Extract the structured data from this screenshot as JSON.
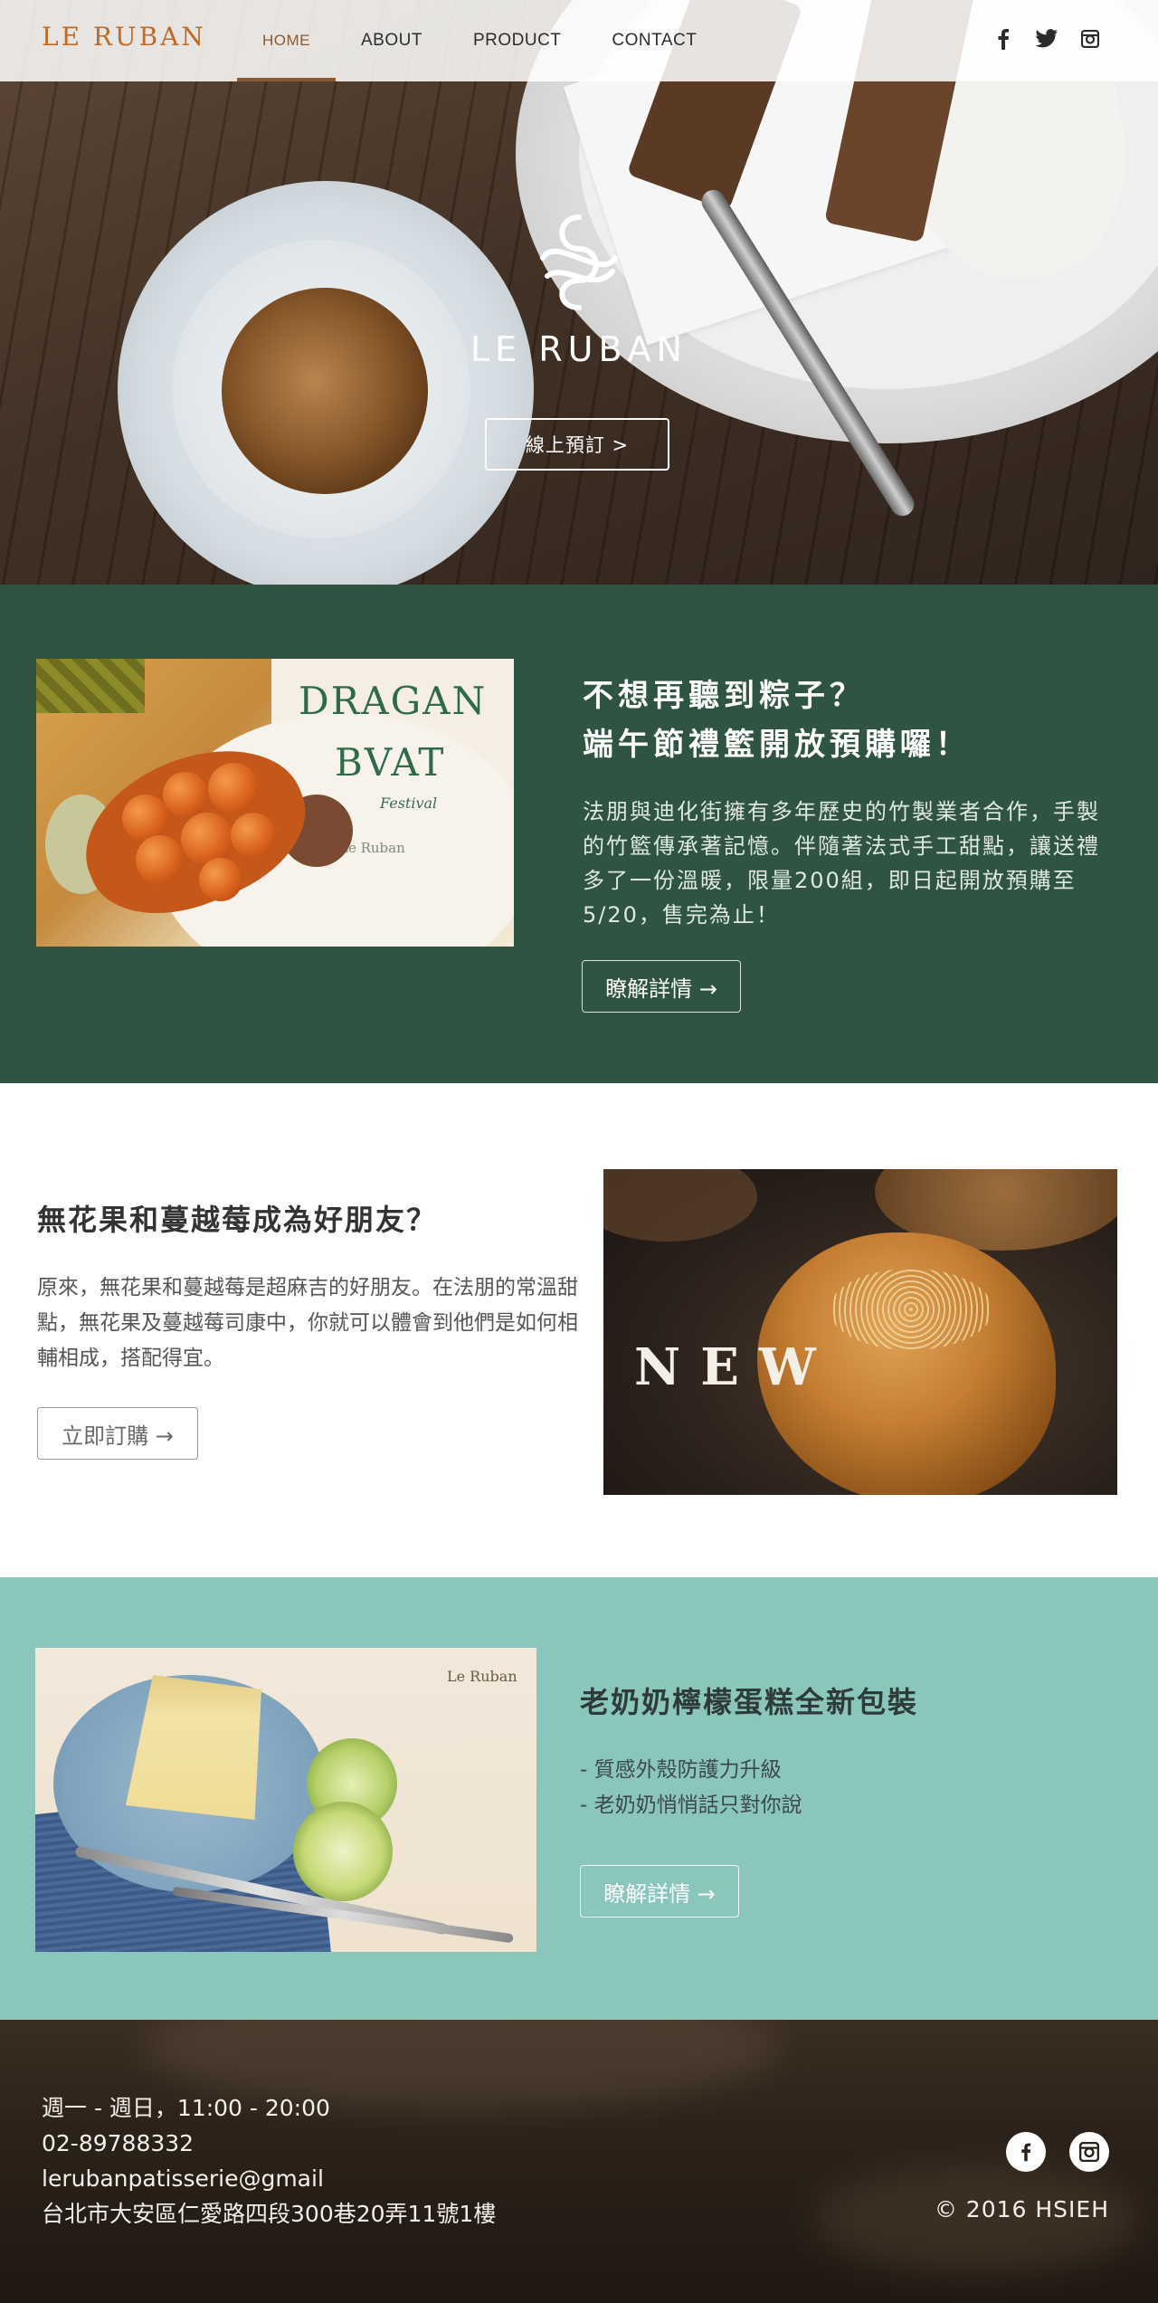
{
  "brand": {
    "logo": "LE RUBAN",
    "accent": "#c06a25"
  },
  "nav": {
    "links": [
      {
        "label": "HOME",
        "active": true
      },
      {
        "label": "ABOUT",
        "active": false
      },
      {
        "label": "PRODUCT",
        "active": false
      },
      {
        "label": "CONTACT",
        "active": false
      }
    ],
    "social_icons": [
      "facebook-icon",
      "twitter-icon",
      "instagram-icon"
    ]
  },
  "hero": {
    "brand": "LE RUBAN",
    "button": "線上預訂 >"
  },
  "section_dragon": {
    "title_line1": "不想再聽到粽子？",
    "title_line2": "端午節禮籃開放預購囉！",
    "body": "法朋與迪化街擁有多年歷史的竹製業者合作，手製的竹籃傳承著記憶。伴隨著法式手工甜點，讓送禮多了一份溫暖，限量200組，即日起開放預購至5/20，售完為止！",
    "button": "瞭解詳情 →",
    "image_text": {
      "line1": "DRAGAN",
      "line2": "BVAT",
      "festival": "Festival",
      "watermark": "Le Ruban"
    },
    "bg_color": "#2f5442"
  },
  "section_fig": {
    "title": "無花果和蔓越莓成為好朋友？",
    "body": "原來，無花果和蔓越莓是超麻吉的好朋友。在法朋的常溫甜點，無花果及蔓越莓司康中，你就可以體會到他們是如何相輔相成，搭配得宜。",
    "button": "立即訂購 →",
    "image_text": "NEW"
  },
  "section_lemon": {
    "title": "老奶奶檸檬蛋糕全新包裝",
    "items": [
      "- 質感外殼防護力升級",
      "- 老奶奶悄悄話只對你說"
    ],
    "button": "瞭解詳情 →",
    "image_text": "Le Ruban",
    "bg_color": "#8ac6bc"
  },
  "footer": {
    "hours": "週一 - 週日，11:00 - 20:00",
    "phone": "02-89788332",
    "email": "lerubanpatisserie@gmail",
    "address": "台北市大安區仁愛路四段300巷20弄11號1樓",
    "copyright": "© 2016  HSIEH",
    "social_icons": [
      "facebook-icon",
      "instagram-icon"
    ]
  }
}
